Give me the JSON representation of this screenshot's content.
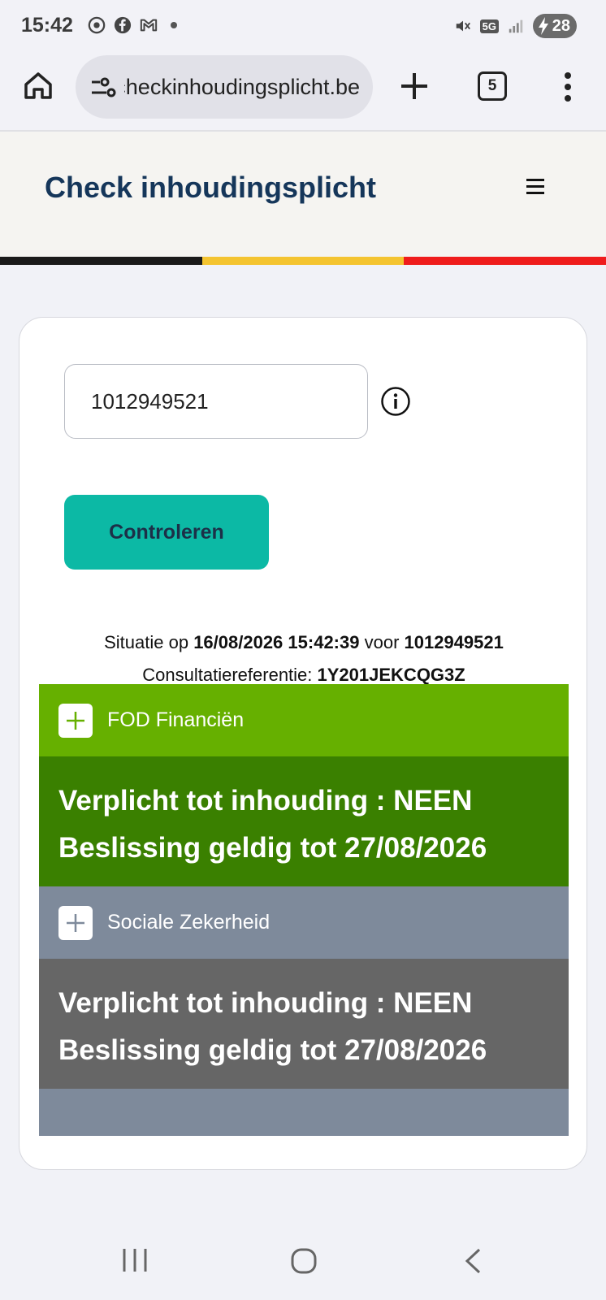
{
  "status_bar": {
    "time": "15:42",
    "network": "5G",
    "battery": "28"
  },
  "browser": {
    "url": "checkinhoudingsplicht.be",
    "tab_count": "5"
  },
  "site": {
    "title": "Check inhoudingsplicht",
    "flag_colors": [
      "#1a1a1a",
      "#f4c430",
      "#ef1c1c"
    ]
  },
  "form": {
    "input_value": "1012949521",
    "button_label": "Controleren"
  },
  "situation": {
    "prefix": "Situatie op ",
    "datetime": "16/08/2026 15:42:39",
    "middle": " voor ",
    "number": "1012949521",
    "ref_label": "Consultatiereferentie: ",
    "ref_value": "1Y201JEKCQG3Z"
  },
  "results": [
    {
      "heading": "FOD Financiën",
      "line1": "Verplicht tot inhouding : NEEN",
      "line2": "Beslissing geldig tot 27/08/2026",
      "head_color": "#66b000",
      "body_color": "#3a8000"
    },
    {
      "heading": "Sociale Zekerheid",
      "line1": "Verplicht tot inhouding : NEEN",
      "line2": "Beslissing geldig tot 27/08/2026",
      "head_color": "#7e8a9b",
      "body_color": "#666666"
    }
  ]
}
